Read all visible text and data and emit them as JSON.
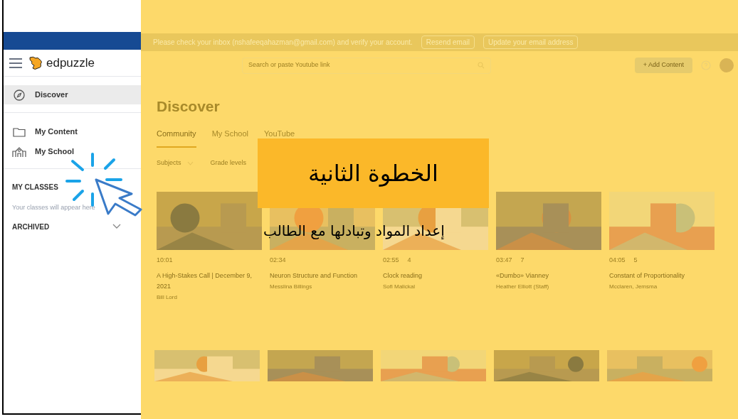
{
  "banner": {
    "message": "Please check your inbox (nshafeeqahazman@gmail.com) and verify your account.",
    "buttons": [
      "Resend email",
      "Update your email address"
    ]
  },
  "header": {
    "logo": "edpuzzle",
    "search_placeholder": "Search or paste Youtube link",
    "add_button": "+ Add Content"
  },
  "sidebar": {
    "items": [
      {
        "label": "Discover",
        "selected": true
      },
      {
        "label": "My Content",
        "selected": false
      },
      {
        "label": "My School",
        "selected": false
      }
    ],
    "classes_heading": "MY CLASSES",
    "classes_empty": "Your classes will appear here",
    "archived": "ARCHIVED"
  },
  "page": {
    "title": "Discover",
    "tabs": [
      {
        "label": "Community",
        "selected": true
      },
      {
        "label": "My School",
        "selected": false
      },
      {
        "label": "YouTube",
        "selected": false
      }
    ],
    "filters": [
      "Subjects",
      "Grade levels"
    ]
  },
  "videos": [
    {
      "duration": "10:01",
      "title": "A High-Stakes Call | December 9, 2021",
      "author": "Bill Lord"
    },
    {
      "duration": "02:34",
      "title": "Neuron Structure and Function",
      "author": "Messlina Billings"
    },
    {
      "duration": "02:55",
      "questions": "4",
      "title": "Clock reading",
      "author": "Sofi Malickal"
    },
    {
      "duration": "03:47",
      "questions": "7",
      "title": "«Dumbo» Vianney",
      "author": "Heather Elliott (Staff)"
    },
    {
      "duration": "04:05",
      "questions": "5",
      "title": "Constant of Proportionality",
      "author": "Mcclaren, Jemsma"
    }
  ],
  "overlay": {
    "title": "الخطوة الثانية",
    "subtitle": "إعداد المواد وتبادلها مع الطالب"
  }
}
